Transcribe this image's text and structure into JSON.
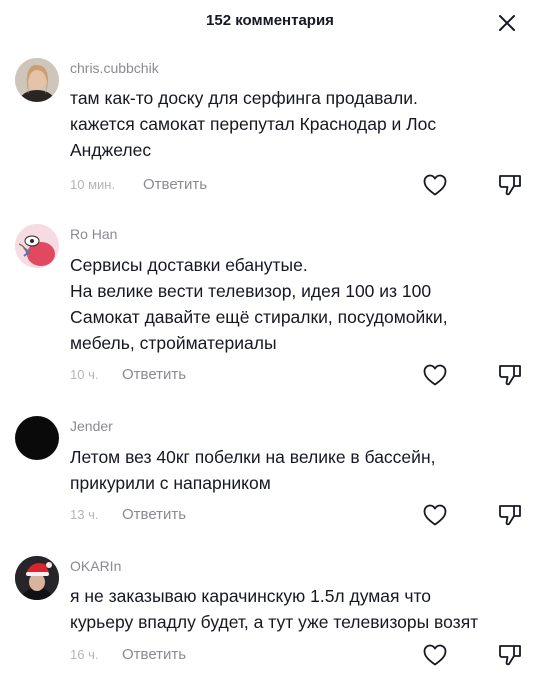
{
  "header": {
    "title": "152 комментария"
  },
  "comments": [
    {
      "username": "chris.cubbchik",
      "lines": [
        "там как-то доску для серфинга продавали.",
        "кажется самокат перепутал Краснодар и Лос",
        "Анджелес"
      ],
      "time": "10 мин.",
      "reply": "Ответить"
    },
    {
      "username": "Ro Han",
      "lines": [
        "Сервисы доставки ебанутые.",
        "На велике вести телевизор, идея 100 из 100",
        "Самокат давайте ещё стиралки, посудомойки,",
        "мебель, стройматериалы"
      ],
      "time": "10 ч.",
      "reply": "Ответить"
    },
    {
      "username": "Jender",
      "lines": [
        "Летом вез 40кг побелки на велике в бассейн,",
        "прикурили с напарником"
      ],
      "time": "13 ч.",
      "reply": "Ответить"
    },
    {
      "username": "OKARIn",
      "lines": [
        "я не заказываю карачинскую 1.5л думая что",
        "курьеру впадлу будет, а тут уже телевизоры возят"
      ],
      "time": "16 ч.",
      "reply": "Ответить"
    }
  ],
  "icons": {
    "close": "close-icon",
    "like": "heart-outline-icon",
    "dislike": "thumbs-down-icon"
  },
  "colors": {
    "text": "#161823",
    "secondary": "#8a8b91",
    "timestamp": "#b4b5ba",
    "background": "#ffffff"
  }
}
